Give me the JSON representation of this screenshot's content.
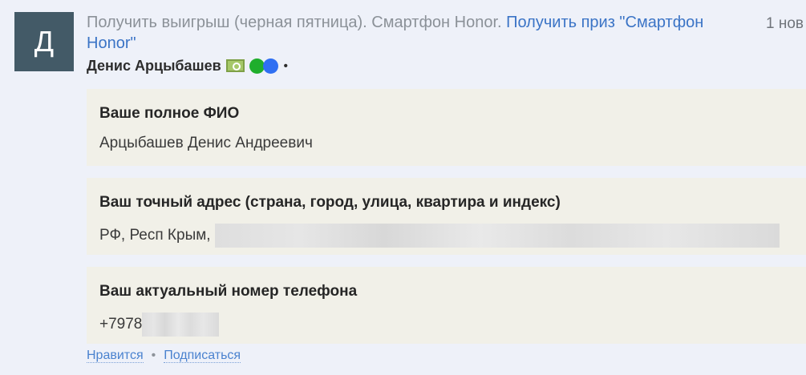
{
  "post": {
    "avatar_letter": "Д",
    "headline_text": "Получить выигрыш (черная пятница). Смартфон Honor. ",
    "headline_link": "Получить приз \"Смартфон Honor\"",
    "time": "1 нов",
    "author": "Денис Арцыбашев",
    "bullet": "•"
  },
  "fields": [
    {
      "label": "Ваше полное ФИО",
      "value": "Арцыбашев Денис Андреевич"
    },
    {
      "label": "Ваш точный адрес (страна, город, улица, квартира и индекс)",
      "value": "РФ, Респ Крым, "
    },
    {
      "label": "Ваш актуальный номер телефона",
      "value": "+7978"
    }
  ],
  "footer": {
    "like": "Нравится",
    "separator": "•",
    "subscribe": "Подписаться"
  },
  "colors": {
    "background": "#eef1f9",
    "card": "#f1f0e8",
    "avatar": "#435a67",
    "link": "#3b74c6"
  }
}
